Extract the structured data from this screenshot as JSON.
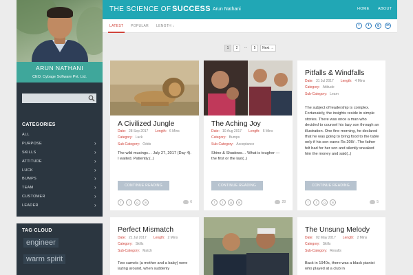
{
  "profile": {
    "name": "ARUN NATHANI",
    "role": "CEO, Cybage Software Pvt. Ltd."
  },
  "search": {
    "placeholder": ""
  },
  "categories": {
    "title": "CATEGORIES",
    "items": [
      "ALL",
      "PURPOSE",
      "SKILLS",
      "ATTITUDE",
      "LUCK",
      "BUMPS",
      "TEAM",
      "CUSTOMER",
      "LEADER"
    ]
  },
  "tag_cloud": {
    "title": "TAG CLOUD",
    "tags": [
      "engineer",
      "warm spirit"
    ]
  },
  "header": {
    "title_prefix": "THE SCIENCE OF",
    "title_bold": "SUCCESS",
    "author": "Arun Nathani",
    "nav": [
      "HOME",
      "ABOUT"
    ]
  },
  "tabs": [
    "LATEST",
    "POPULAR",
    "LENGTH ↓"
  ],
  "social_icons": [
    "facebook-icon",
    "twitter-icon",
    "googleplus-icon",
    "linkedin-icon"
  ],
  "pagination": [
    "1",
    "2",
    "…",
    "5",
    "Next →"
  ],
  "labels": {
    "date": "Date:",
    "length": "Length:",
    "category": "Category:",
    "subcategory": "Sub-Category:",
    "continue": "CONTINUE READING"
  },
  "posts": [
    {
      "title": "A Civilized Jungle",
      "date": "28 Sep 2017",
      "length": "6 Mins",
      "category": "Luck",
      "subcategory": "Odds",
      "excerpt": "The wild musings…      July 27, 2017 (Day 4). I waited. Patiently.(..)",
      "comments": "6"
    },
    {
      "title": "The Aching Joy",
      "date": "10 Aug 2017",
      "length": "6 Mins",
      "category": "Bumps",
      "subcategory": "Acceptance",
      "excerpt": "Shine & Shadows…      What is tougher — the first or the last(..)",
      "comments": "28"
    },
    {
      "title": "Pitfalls & Windfalls",
      "date": "31 Jul 2017",
      "length": "4 Mins",
      "category": "Attitude",
      "subcategory": "Learn",
      "excerpt": "The subject of leadership is complex. Fortunately, the insights reside in simple stories.     There was once a man who decided to counsel his lazy son through an illustration. One fine morning, he declared that he was going to bring food to the table only if his son earns Rs 200/-. The father felt bad for her son and silently sneaked him the money and said(..)",
      "comments": "5"
    },
    {
      "title": "Perfect Mismatch",
      "date": "21 Jul 2017",
      "length": "2 Mins",
      "category": "Skills",
      "subcategory": "Match",
      "excerpt": "Two camels (a mother and a baby) were lazing around, when suddenly"
    },
    {
      "title": "The Unsung Melody",
      "date": "02 May 2017",
      "length": "2 Mins",
      "category": "Skills",
      "subcategory": "Results",
      "excerpt": "Back in 1940s, there was a black pianist who played at a club in"
    }
  ]
}
